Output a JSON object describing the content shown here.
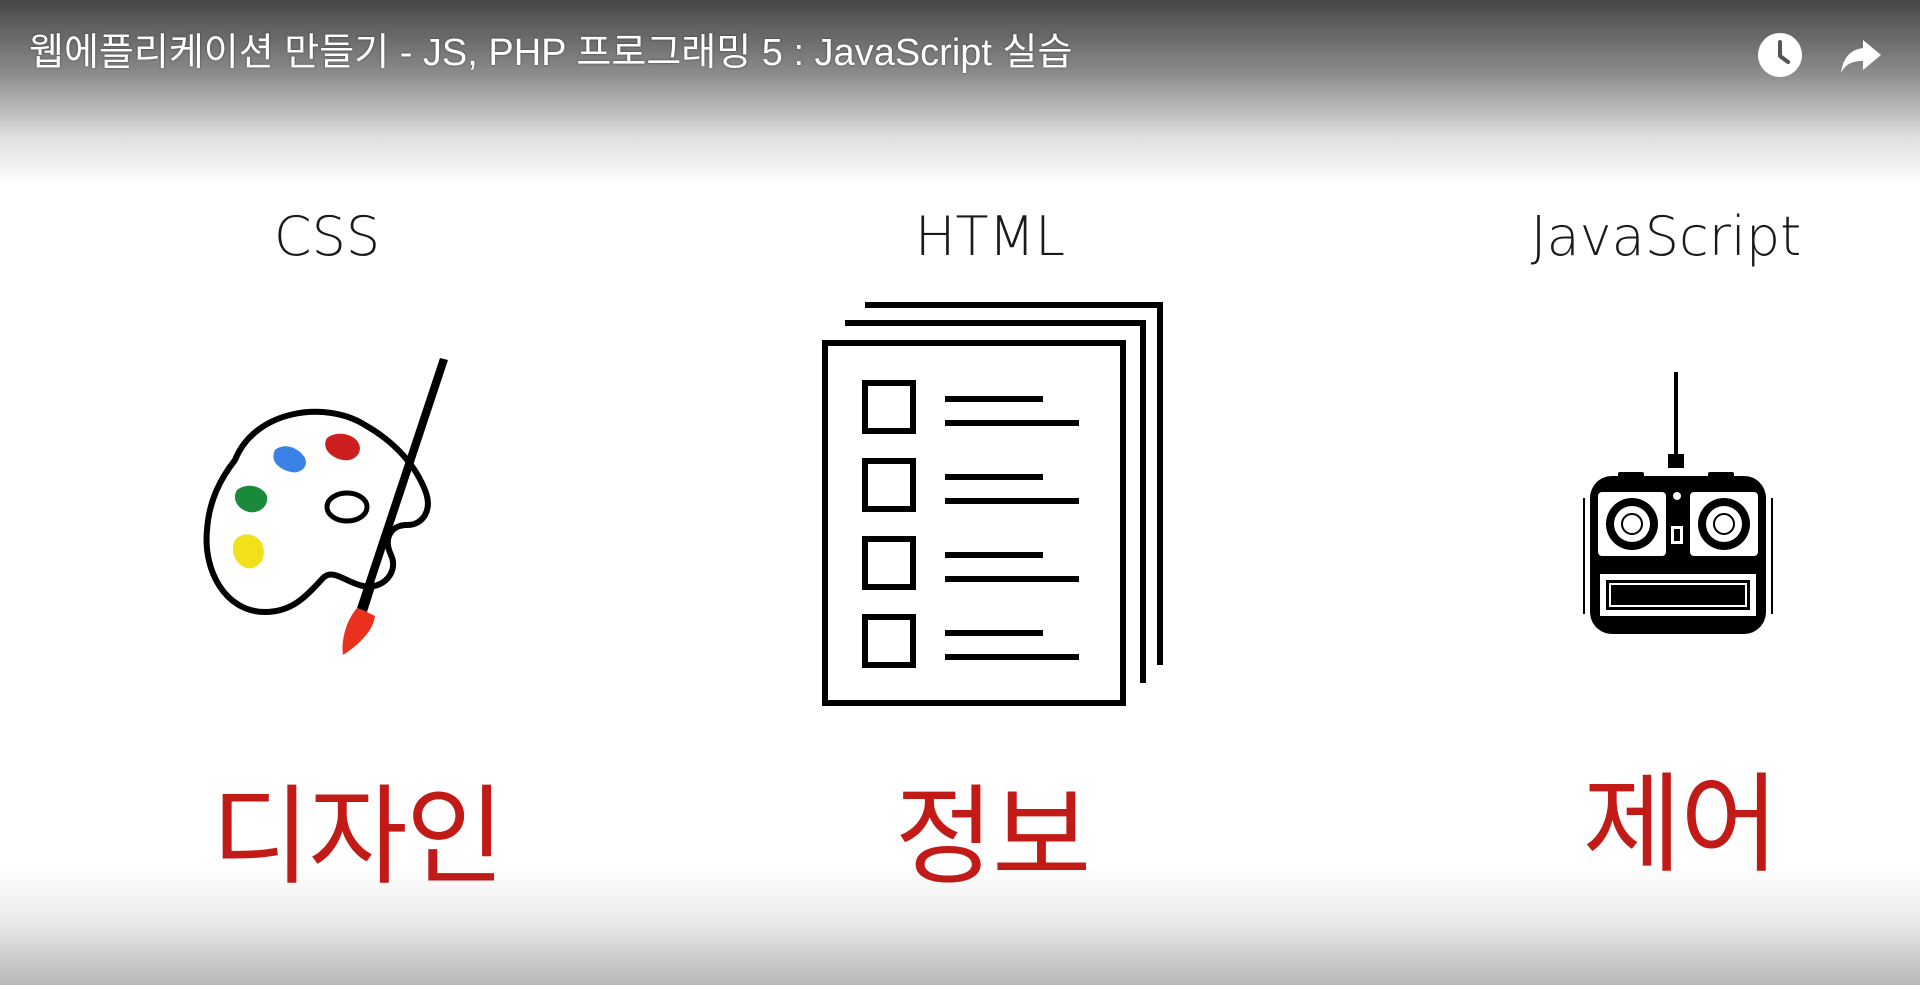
{
  "video": {
    "title": "웹에플리케이션 만들기 - JS, PHP 프로그래밍 5 : JavaScript 실습"
  },
  "top_controls": {
    "watch_later_icon": "clock-icon",
    "share_icon": "share-arrow-icon"
  },
  "slide": {
    "columns": [
      {
        "heading": "CSS",
        "illustration": "paint-palette-icon",
        "word": "디자인"
      },
      {
        "heading": "HTML",
        "illustration": "document-checklist-icon",
        "word": "정보"
      },
      {
        "heading": "JavaScript",
        "illustration": "remote-controller-icon",
        "word": "제어"
      }
    ],
    "colors": {
      "word": "#c21b17",
      "heading": "#1a1a1a",
      "paint_blue": "#3b82e8",
      "paint_red": "#cc1f1f",
      "paint_green": "#1a8a3a",
      "paint_yellow": "#f2e01a",
      "brush_tip": "#e8321e"
    }
  }
}
